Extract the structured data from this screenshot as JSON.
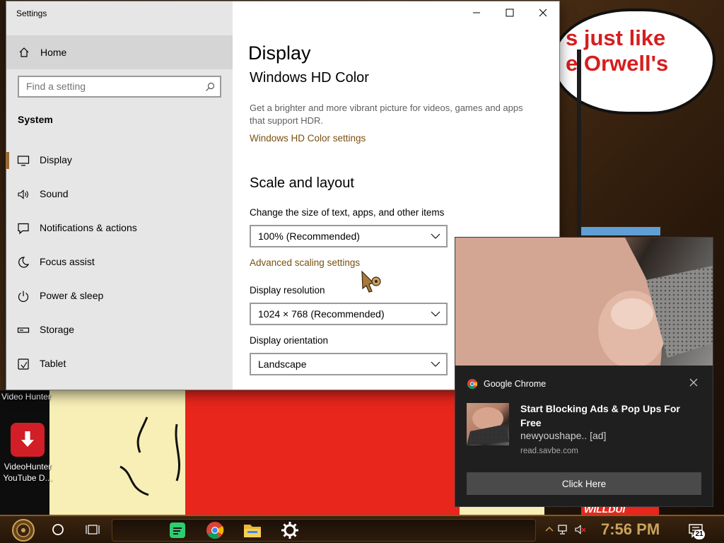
{
  "wallpaper": {
    "bubble_text": "s just like\ne Orwell's",
    "bottom_banner_text": "WILLDUI"
  },
  "desktop": {
    "top_label": "Video Hunter",
    "icons": [
      {
        "label": "VideoHunter\nYouTube D...",
        "icon": "videohunter-icon"
      }
    ]
  },
  "settings": {
    "window_title": "Settings",
    "home_label": "Home",
    "search_placeholder": "Find a setting",
    "section_title": "System",
    "nav_items": [
      {
        "label": "Display",
        "icon": "monitor-icon",
        "active": true
      },
      {
        "label": "Sound",
        "icon": "speaker-icon",
        "active": false
      },
      {
        "label": "Notifications & actions",
        "icon": "notification-icon",
        "active": false
      },
      {
        "label": "Focus assist",
        "icon": "moon-icon",
        "active": false
      },
      {
        "label": "Power & sleep",
        "icon": "power-icon",
        "active": false
      },
      {
        "label": "Storage",
        "icon": "storage-icon",
        "active": false
      },
      {
        "label": "Tablet",
        "icon": "tablet-icon",
        "active": false
      }
    ],
    "page_title": "Display",
    "hd_color": {
      "heading": "Windows HD Color",
      "description": "Get a brighter and more vibrant picture for videos, games and apps that support HDR.",
      "link": "Windows HD Color settings"
    },
    "scale_layout": {
      "heading": "Scale and layout",
      "size_label": "Change the size of text, apps, and other items",
      "size_value": "100% (Recommended)",
      "advanced_link": "Advanced scaling settings",
      "resolution_label": "Display resolution",
      "resolution_value": "1024 × 768 (Recommended)",
      "orientation_label": "Display orientation",
      "orientation_value": "Landscape"
    }
  },
  "notification": {
    "app_name": "Google Chrome",
    "title": "Start Blocking Ads & Pop Ups For Free",
    "body": "newyoushape.. [ad]",
    "source": "read.savbe.com",
    "button_label": "Click Here"
  },
  "taskbar": {
    "pinned_apps": [
      "spotify-icon",
      "chrome-icon",
      "file-explorer-icon",
      "settings-gear-icon"
    ],
    "clock": "7:56 PM",
    "notification_count": "21"
  },
  "colors": {
    "accent_link": "#7a4f10",
    "taskbar_clock": "#c9a35a",
    "active_nav_bar": "#a06a24"
  }
}
